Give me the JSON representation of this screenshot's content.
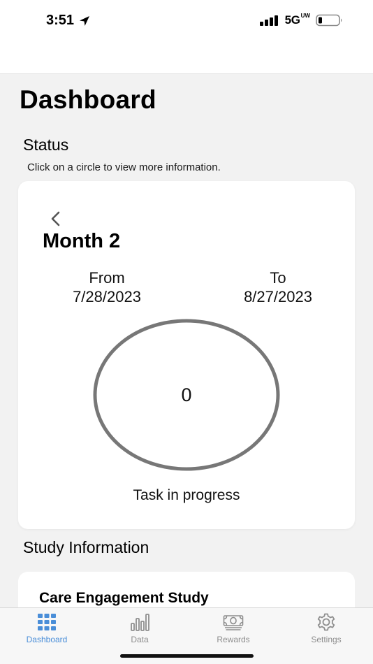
{
  "status_bar": {
    "time": "3:51",
    "network": "5G",
    "network_sup": "UW"
  },
  "page": {
    "title": "Dashboard"
  },
  "status_section": {
    "heading": "Status",
    "hint": "Click on a circle to view more information."
  },
  "status_card": {
    "month_title": "Month 2",
    "from_label": "From",
    "from_date": "7/28/2023",
    "to_label": "To",
    "to_date": "8/27/2023",
    "circle_value": "0",
    "circle_caption": "Task in progress"
  },
  "study_section": {
    "heading": "Study Information",
    "card_title": "Care Engagement Study"
  },
  "tab_bar": {
    "active": "Dashboard",
    "tabs": [
      {
        "label": "Dashboard",
        "icon": "grid-icon"
      },
      {
        "label": "Data",
        "icon": "bar-chart-icon"
      },
      {
        "label": "Rewards",
        "icon": "money-icon"
      },
      {
        "label": "Settings",
        "icon": "gear-icon"
      }
    ]
  },
  "colors": {
    "accent": "#4a8ed8",
    "circle_stroke": "#777777",
    "inactive_tab": "#8e8e8e",
    "background": "#f2f2f2",
    "card": "#ffffff"
  }
}
